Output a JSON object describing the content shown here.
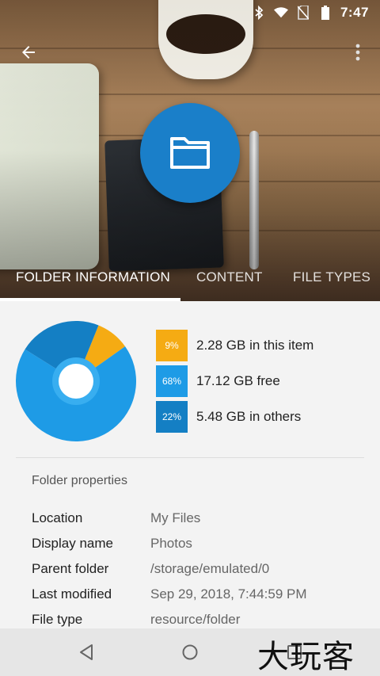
{
  "status_bar": {
    "time": "7:47"
  },
  "tabs": [
    {
      "label": "FOLDER INFORMATION"
    },
    {
      "label": "CONTENT"
    },
    {
      "label": "FILE TYPES"
    }
  ],
  "storage": {
    "items": [
      {
        "percent": "9%",
        "text": "2.28 GB in this item",
        "color": "#f5ab13",
        "fraction": 0.09
      },
      {
        "percent": "68%",
        "text": "17.12 GB free",
        "color": "#1e9be6",
        "fraction": 0.68
      },
      {
        "percent": "22%",
        "text": "5.48 GB in others",
        "color": "#147fc4",
        "fraction": 0.22
      }
    ]
  },
  "properties": {
    "title": "Folder properties",
    "rows": [
      {
        "label": "Location",
        "value": "My Files"
      },
      {
        "label": "Display name",
        "value": "Photos"
      },
      {
        "label": "Parent folder",
        "value": "/storage/emulated/0"
      },
      {
        "label": "Last modified",
        "value": "Sep 29, 2018, 7:44:59 PM"
      },
      {
        "label": "File type",
        "value": "resource/folder"
      }
    ]
  },
  "watermark": "大玩客",
  "colors": {
    "accent": "#1a7fc9",
    "navbar": "#e6e6e6"
  },
  "icons": [
    "bluetooth-icon",
    "wifi-icon",
    "no-sim-icon",
    "battery-icon",
    "back-arrow-icon",
    "more-vert-icon",
    "folder-icon",
    "nav-back-icon",
    "nav-home-icon",
    "nav-recents-icon"
  ]
}
